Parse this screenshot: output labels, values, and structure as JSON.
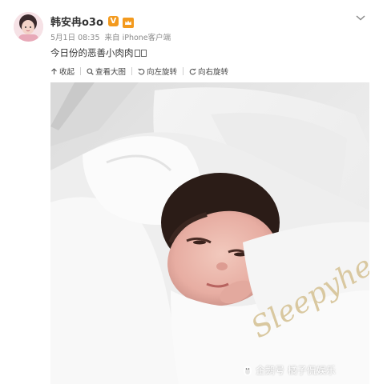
{
  "post": {
    "username": "韩安冉o3o",
    "verified_badge": "V",
    "date": "5月1日 08:35",
    "source_prefix": "来自",
    "source": "iPhone客户端",
    "text": "今日份的恶善小肉肉",
    "text_tail_glyphs": "□□"
  },
  "toolbar": {
    "collapse": "收起",
    "view_large": "查看大图",
    "rotate_left": "向左旋转",
    "rotate_right": "向右旋转"
  },
  "watermark": {
    "label": "企鹅号 橘子侃娱乐"
  },
  "photo": {
    "embroidery_text": "Sleepyhead DELUXE"
  },
  "colors": {
    "username": "#333333",
    "meta": "#8a8a8a",
    "badge": "#f39a1e",
    "embroidery": "#d9c8a0"
  }
}
